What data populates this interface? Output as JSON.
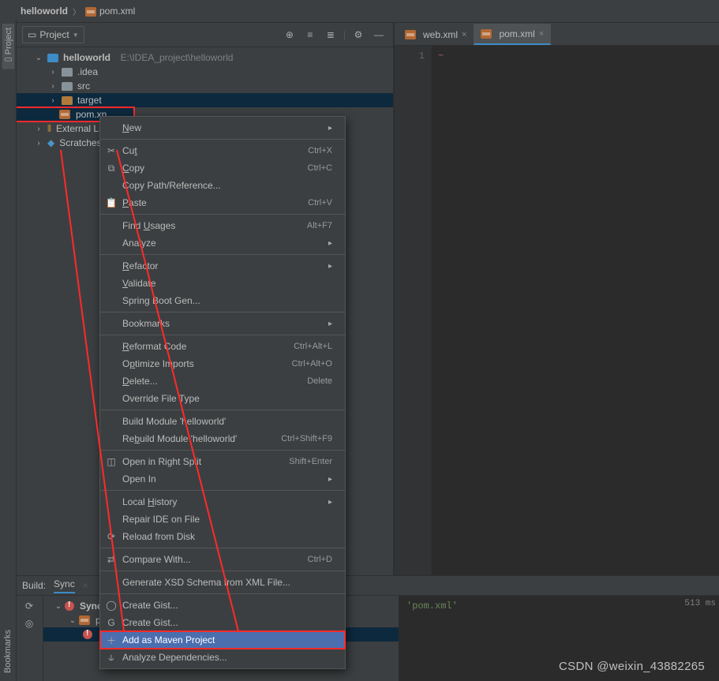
{
  "breadcrumb": {
    "root": "helloworld",
    "file": "pom.xml"
  },
  "sidebar": {
    "labels": [
      "Project",
      "Bookmarks"
    ]
  },
  "project_pane": {
    "title": "Project",
    "tree": {
      "project_name": "helloworld",
      "project_path": "E:\\IDEA_project\\helloworld",
      "children": [
        ".idea",
        "src",
        "target",
        "pom.xn"
      ],
      "external": "External Li",
      "scratches": "Scratches"
    }
  },
  "editor": {
    "tabs": [
      {
        "label": "web.xml",
        "active": false
      },
      {
        "label": "pom.xml",
        "active": true
      }
    ],
    "gutter": "1",
    "line_marker": "~"
  },
  "context_menu": [
    {
      "label": "New",
      "submenu": true,
      "under": 0
    },
    "sep",
    {
      "label": "Cut",
      "shortcut": "Ctrl+X",
      "icon": "scissors",
      "under": 2
    },
    {
      "label": "Copy",
      "shortcut": "Ctrl+C",
      "icon": "copy",
      "under": 0
    },
    {
      "label": "Copy Path/Reference..."
    },
    {
      "label": "Paste",
      "shortcut": "Ctrl+V",
      "icon": "paste",
      "under": 0
    },
    "sep",
    {
      "label": "Find Usages",
      "shortcut": "Alt+F7",
      "under": 5
    },
    {
      "label": "Analyze",
      "submenu": true
    },
    "sep",
    {
      "label": "Refactor",
      "submenu": true,
      "under": 0
    },
    {
      "label": "Validate",
      "under": 0
    },
    {
      "label": "Spring Boot Gen..."
    },
    "sep",
    {
      "label": "Bookmarks",
      "submenu": true
    },
    "sep",
    {
      "label": "Reformat Code",
      "shortcut": "Ctrl+Alt+L",
      "under": 0
    },
    {
      "label": "Optimize Imports",
      "shortcut": "Ctrl+Alt+O",
      "under": 1
    },
    {
      "label": "Delete...",
      "shortcut": "Delete",
      "under": 0
    },
    {
      "label": "Override File Type"
    },
    "sep",
    {
      "label": "Build Module 'helloworld'"
    },
    {
      "label": "Rebuild Module 'helloworld'",
      "shortcut": "Ctrl+Shift+F9",
      "under": 2
    },
    "sep",
    {
      "label": "Open in Right Split",
      "shortcut": "Shift+Enter",
      "icon": "split"
    },
    {
      "label": "Open In",
      "submenu": true
    },
    "sep",
    {
      "label": "Local History",
      "submenu": true,
      "under": 6
    },
    {
      "label": "Repair IDE on File"
    },
    {
      "label": "Reload from Disk",
      "icon": "reload"
    },
    "sep",
    {
      "label": "Compare With...",
      "shortcut": "Ctrl+D",
      "icon": "compare"
    },
    "sep",
    {
      "label": "Generate XSD Schema from XML File..."
    },
    "sep",
    {
      "label": "Create Gist...",
      "icon": "github"
    },
    {
      "label": "Create Gist...",
      "icon": "gitee"
    },
    {
      "label": "Add as Maven Project",
      "icon": "plus",
      "highlight": true
    },
    {
      "label": "Analyze Dependencies...",
      "icon": "chart"
    }
  ],
  "build_panel": {
    "title": "Build:",
    "tab": "Sync",
    "tree": {
      "root": "Sync:",
      "child": "po",
      "grand": ""
    },
    "time": "513 ms",
    "pom_string": "'pom.xml'"
  },
  "watermark": "CSDN @weixin_43882265"
}
